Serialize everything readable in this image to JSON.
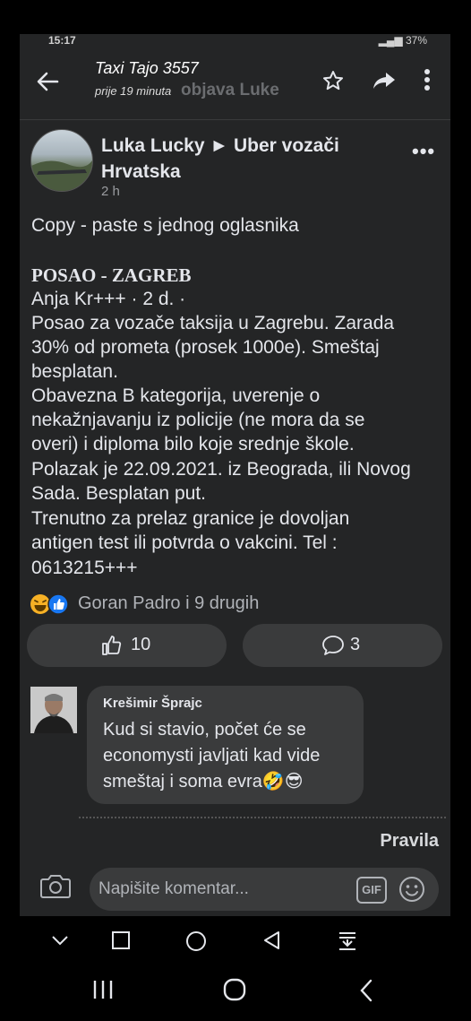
{
  "status_bar": {
    "time": "15:17",
    "battery": "37%"
  },
  "header": {
    "title": "Taxi Tajo 3557",
    "subtitle": "prije 19 minuta",
    "ghost_text": "objava Luke"
  },
  "post": {
    "author": "Luka Lucky ► Uber vozači Hrvatska",
    "time": "2 h",
    "intro": "Copy - paste s jednog oglasnika",
    "heading": "POSAO - ZAGREB",
    "meta": "Anja Kr+++ · 2 d.  ·",
    "body_lines": [
      "Posao za vozače taksija u Zagrebu. Zarada",
      "30% od prometa (prosek 1000e). Smeštaj",
      "besplatan.",
      "Obavezna B kategorija, uverenje o",
      "nekažnjavanju iz policije (ne mora da se",
      "overi) i diploma bilo koje srednje škole.",
      "Polazak je 22.09.2021. iz Beograda, ili Novog",
      "Sada. Besplatan put.",
      "Trenutno za prelaz granice je dovoljan",
      "antigen test ili potvrda o vakcini. Tel :",
      "0613215+++"
    ]
  },
  "reactions": {
    "text": "Goran Padro i 9 drugih"
  },
  "actions": {
    "like_count": "10",
    "comment_count": "3"
  },
  "comment": {
    "name": "Krešimir Šprajc",
    "lines": [
      "Kud si stavio, počet će se",
      "economysti javljati kad vide",
      "smeštaj i soma evra🤣😎"
    ]
  },
  "footer": {
    "rules_label": "Pravila",
    "input_placeholder": "Napišite komentar...",
    "gif_label": "GIF"
  },
  "colors": {
    "background": "#242526",
    "bubble": "#3a3b3c",
    "like_blue": "#1877f2",
    "haha_yellow": "#f7b125"
  }
}
